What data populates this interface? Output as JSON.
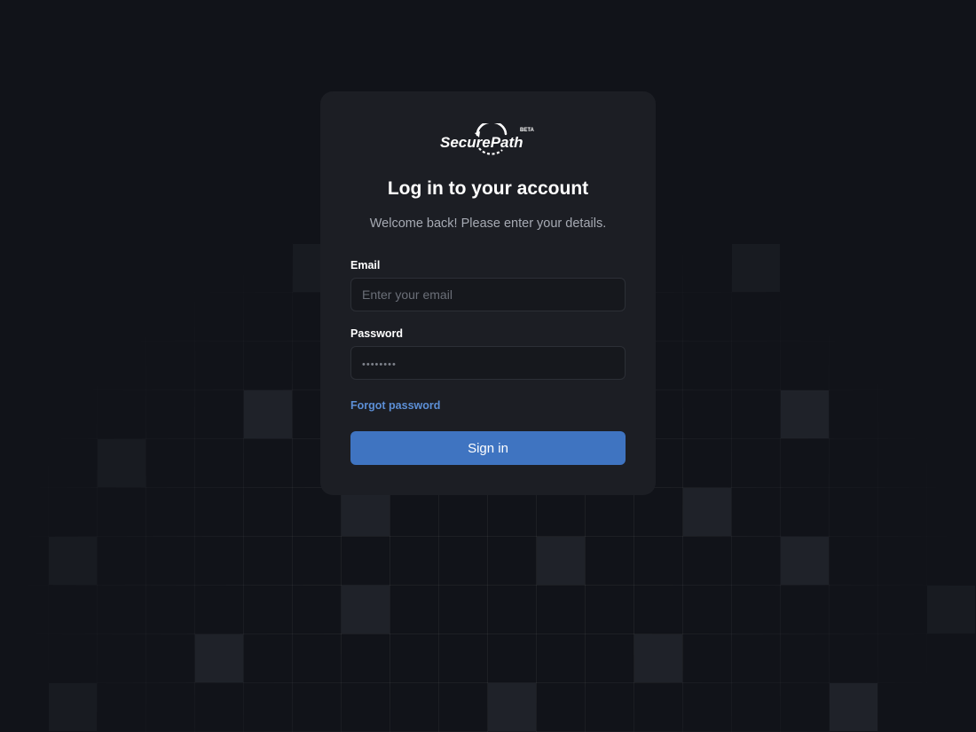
{
  "brand": {
    "name": "SecurePath",
    "badge": "BETA",
    "logo_icon": "circular-arrow-path-icon"
  },
  "login": {
    "title": "Log in to your account",
    "subtitle": "Welcome back! Please enter your details.",
    "email_label": "Email",
    "email_placeholder": "Enter your email",
    "password_label": "Password",
    "password_placeholder": "••••••••",
    "forgot_link": "Forgot password",
    "submit_label": "Sign in"
  },
  "colors": {
    "background": "#111319",
    "card": "#1c1e24",
    "accent": "#3f74c1",
    "link": "#5c8fd6"
  }
}
